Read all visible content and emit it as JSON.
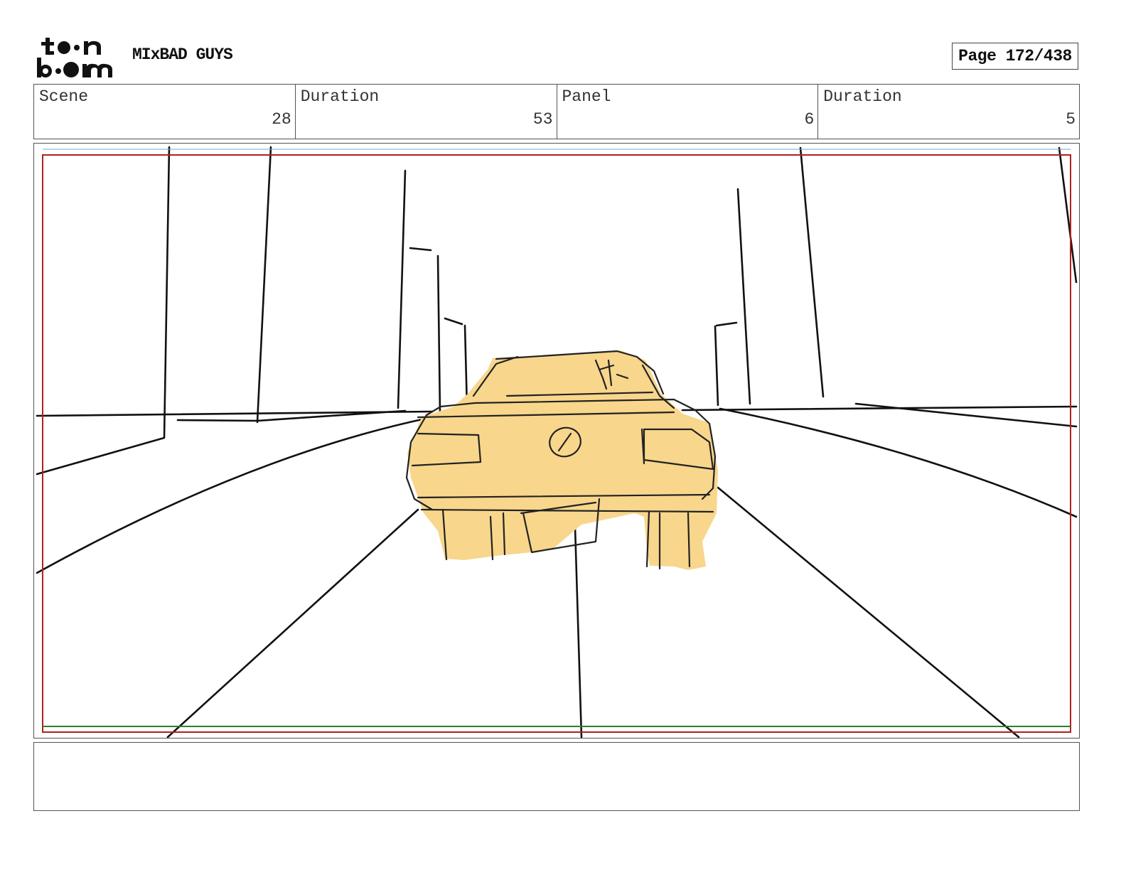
{
  "header": {
    "logo_text": "toon boom",
    "project_title": "MIxBAD GUYS",
    "page_label": "Page 172/438"
  },
  "info": {
    "scene_label": "Scene",
    "scene_value": "28",
    "scene_duration_label": "Duration",
    "scene_duration_value": "53",
    "panel_label": "Panel",
    "panel_value": "6",
    "panel_duration_label": "Duration",
    "panel_duration_value": "5"
  },
  "panel": {
    "car_fill_color": "#f8d68c",
    "safe_frame_color": "#b02020",
    "bottom_line_color": "#2e7d32"
  },
  "notes": {
    "text": ""
  }
}
